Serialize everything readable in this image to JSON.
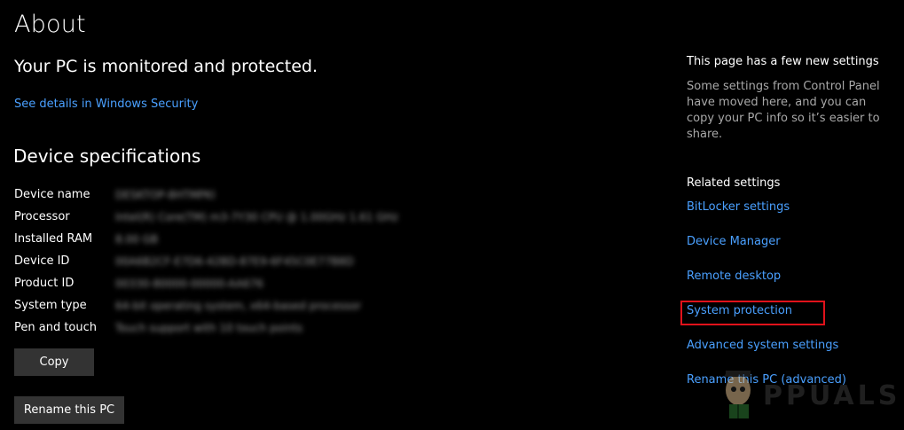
{
  "header": {
    "title": "About",
    "status": "Your PC is monitored and protected.",
    "security_link": "See details in Windows Security"
  },
  "specs": {
    "title": "Device specifications",
    "rows": [
      {
        "label": "Device name",
        "value": "DESKTOP-8HTMPKI"
      },
      {
        "label": "Processor",
        "value": "Intel(R) Core(TM) m3-7Y30 CPU @ 1.00GHz   1.61 GHz"
      },
      {
        "label": "Installed RAM",
        "value": "8.00 GB"
      },
      {
        "label": "Device ID",
        "value": "00A6B2CF-E7D6-42BD-87E9-6F45C0E77B8D"
      },
      {
        "label": "Product ID",
        "value": "00330-80000-00000-AA676"
      },
      {
        "label": "System type",
        "value": "64-bit operating system, x64-based processor"
      },
      {
        "label": "Pen and touch",
        "value": "Touch support with 10 touch points"
      }
    ],
    "copy_label": "Copy"
  },
  "rename_label": "Rename this PC",
  "side": {
    "new_settings_title": "This page has a few new settings",
    "new_settings_desc": "Some settings from Control Panel have moved here, and you can copy your PC info so it’s easier to share.",
    "related_title": "Related settings",
    "links": [
      "BitLocker settings",
      "Device Manager",
      "Remote desktop",
      "System protection",
      "Advanced system settings",
      "Rename this PC (advanced)"
    ]
  },
  "colors": {
    "background": "#000000",
    "link": "#4aa0ff",
    "highlight": "#e0121b",
    "button": "#333333"
  },
  "icons": {
    "watermark": "appuals-logo-icon"
  }
}
